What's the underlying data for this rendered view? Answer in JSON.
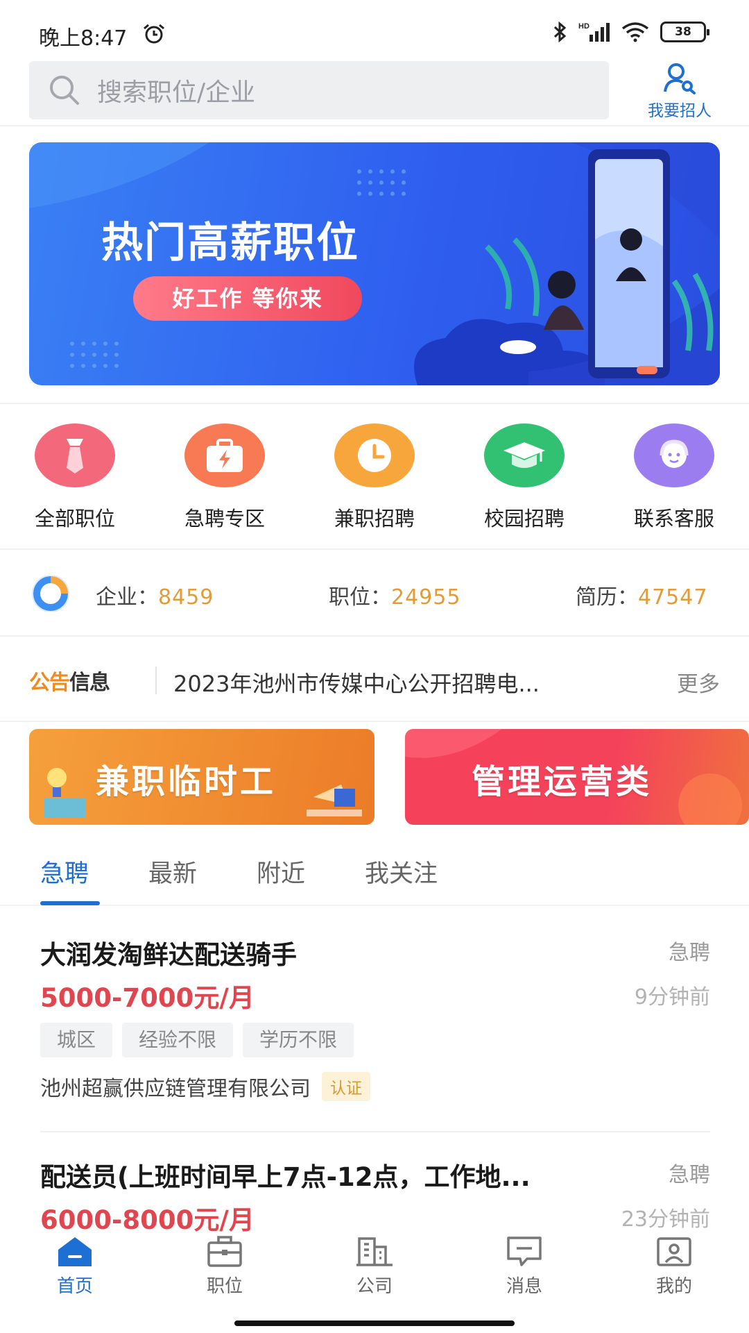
{
  "status_bar": {
    "time": "晚上8:47",
    "network": "HD",
    "battery": "38"
  },
  "search": {
    "placeholder": "搜索职位/企业"
  },
  "recruit": {
    "label": "我要招人"
  },
  "banner": {
    "title": "热门高薪职位",
    "subtitle": "好工作 等你来"
  },
  "quick_nav": [
    {
      "label": "全部职位",
      "icon": "tie-icon",
      "color": "#f2627a"
    },
    {
      "label": "急聘专区",
      "icon": "lightning-bag-icon",
      "color": "#f5734c"
    },
    {
      "label": "兼职招聘",
      "icon": "clock-icon",
      "color": "#f7a235"
    },
    {
      "label": "校园招聘",
      "icon": "graduation-cap-icon",
      "color": "#2fbd6e"
    },
    {
      "label": "联系客服",
      "icon": "customer-service-icon",
      "color": "#9678ec"
    }
  ],
  "stats": {
    "company_label": "企业：",
    "company_value": "8459",
    "job_label": "职位：",
    "job_value": "24955",
    "resume_label": "简历：",
    "resume_value": "47547"
  },
  "notice": {
    "logo_accent": "公告",
    "logo_rest": "信息",
    "text": "2023年池州市传媒中心公开招聘电...",
    "more": "更多"
  },
  "categories": [
    {
      "label": "兼职临时工",
      "color": "#f08a2c"
    },
    {
      "label": "管理运营类",
      "color": "#f03b55"
    }
  ],
  "tabs": [
    "急聘",
    "最新",
    "附近",
    "我关注"
  ],
  "active_tab": "急聘",
  "jobs": [
    {
      "title": "大润发淘鲜达配送骑手",
      "urgent": "急聘",
      "salary": "5000-7000元/月",
      "time": "9分钟前",
      "tags": [
        "城区",
        "经验不限",
        "学历不限"
      ],
      "company": "池州超赢供应链管理有限公司",
      "badge": "认证"
    },
    {
      "title": "配送员(上班时间早上7点-12点，工作地...",
      "urgent": "急聘",
      "salary": "6000-8000元/月",
      "time": "23分钟前"
    }
  ],
  "bottom_nav": [
    {
      "label": "首页",
      "icon": "home-icon"
    },
    {
      "label": "职位",
      "icon": "briefcase-icon"
    },
    {
      "label": "公司",
      "icon": "building-icon"
    },
    {
      "label": "消息",
      "icon": "message-icon"
    },
    {
      "label": "我的",
      "icon": "profile-card-icon"
    }
  ],
  "active_nav": "首页",
  "colors": {
    "primary": "#1e6fd4",
    "salary": "#e0464f",
    "stat_number": "#e59a38"
  }
}
